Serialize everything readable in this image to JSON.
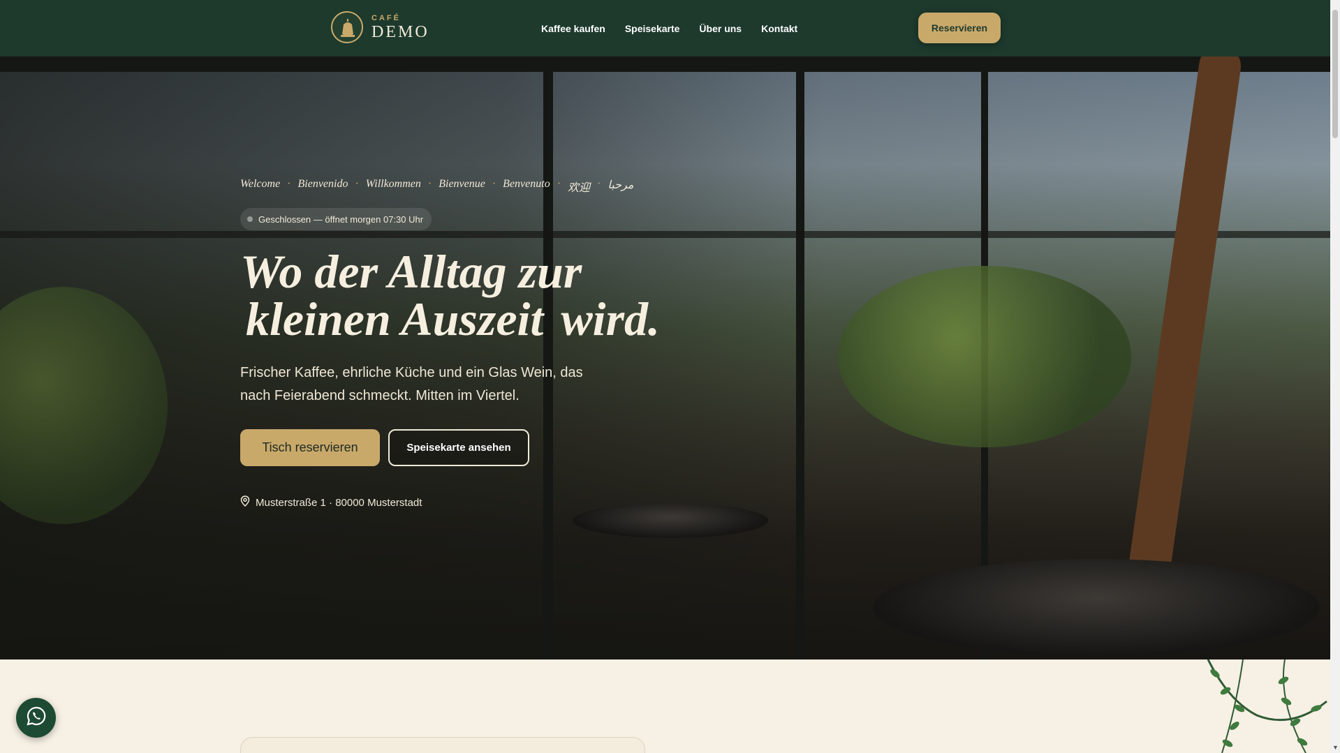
{
  "header": {
    "logo_small": "CAFÉ",
    "logo_big": "DEMO",
    "nav": [
      "Kaffee kaufen",
      "Speisekarte",
      "Über uns",
      "Kontakt"
    ],
    "reserve_label": "Reservieren"
  },
  "hero": {
    "greetings": [
      "Welcome",
      "Bienvenido",
      "Willkommen",
      "Bienvenue",
      "Benvenuto",
      "欢迎",
      "مرحبا"
    ],
    "greeting_separator": "·",
    "status": "Geschlossen — öffnet morgen 07:30 Uhr",
    "headline_line1": "Wo der Alltag zur",
    "headline_highlight": "kleinen Auszeit",
    "headline_end": "wird.",
    "subtext": "Frischer Kaffee, ehrliche Küche und ein Glas Wein, das nach Feierabend schmeckt. Mitten im Viertel.",
    "primary_button": "Tisch reservieren",
    "secondary_button": "Speisekarte ansehen",
    "address": "Musterstraße 1 · 80000 Musterstadt"
  },
  "colors": {
    "header_bg": "#1d3a2d",
    "accent": "#c9a96a",
    "page_bg": "#f7f0e4"
  },
  "icons": {
    "logo": "coffee-pot-icon",
    "location": "map-pin-icon",
    "whatsapp": "whatsapp-icon"
  }
}
